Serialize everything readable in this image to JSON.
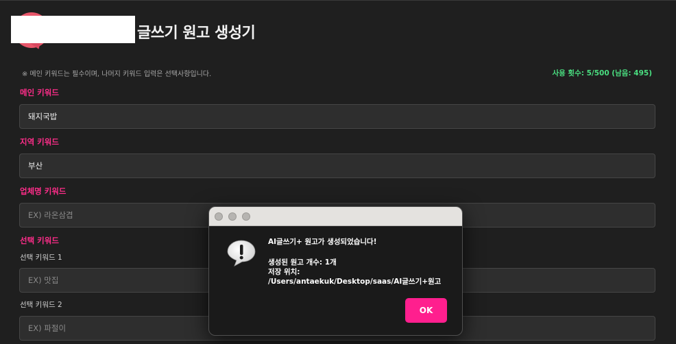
{
  "app": {
    "title": "글쓰기 원고 생성기"
  },
  "notice": "※ 메인 키워드는 필수이며, 나머지 키워드 입력은 선택사항입니다.",
  "usage": "사용 횟수: 5/500 (남음: 495)",
  "fields": {
    "main": {
      "label": "메인 키워드",
      "value": "돼지국밥"
    },
    "region": {
      "label": "지역 키워드",
      "value": "부산"
    },
    "business": {
      "label": "업체명 키워드",
      "placeholder": "EX) 라온삼겹"
    },
    "optional": {
      "label": "선택 키워드",
      "kw1": {
        "label": "선택 키워드 1",
        "placeholder": "EX) 맛집"
      },
      "kw2": {
        "label": "선택 키워드 2",
        "placeholder": "EX) 파절이"
      }
    }
  },
  "dialog": {
    "heading": "AI글쓰기+ 원고가 생성되었습니다!",
    "count_line": "생성된 원고 개수: 1개",
    "location_label": "저장 위치:",
    "location_path": "/Users/antaekuk/Desktop/saas/AI글쓰기+원고",
    "ok_label": "OK",
    "icon": "exclamation-alert-icon"
  },
  "colors": {
    "accent_pink": "#ff2d8a",
    "usage_green": "#4ade80",
    "background": "#1f1f1f"
  }
}
